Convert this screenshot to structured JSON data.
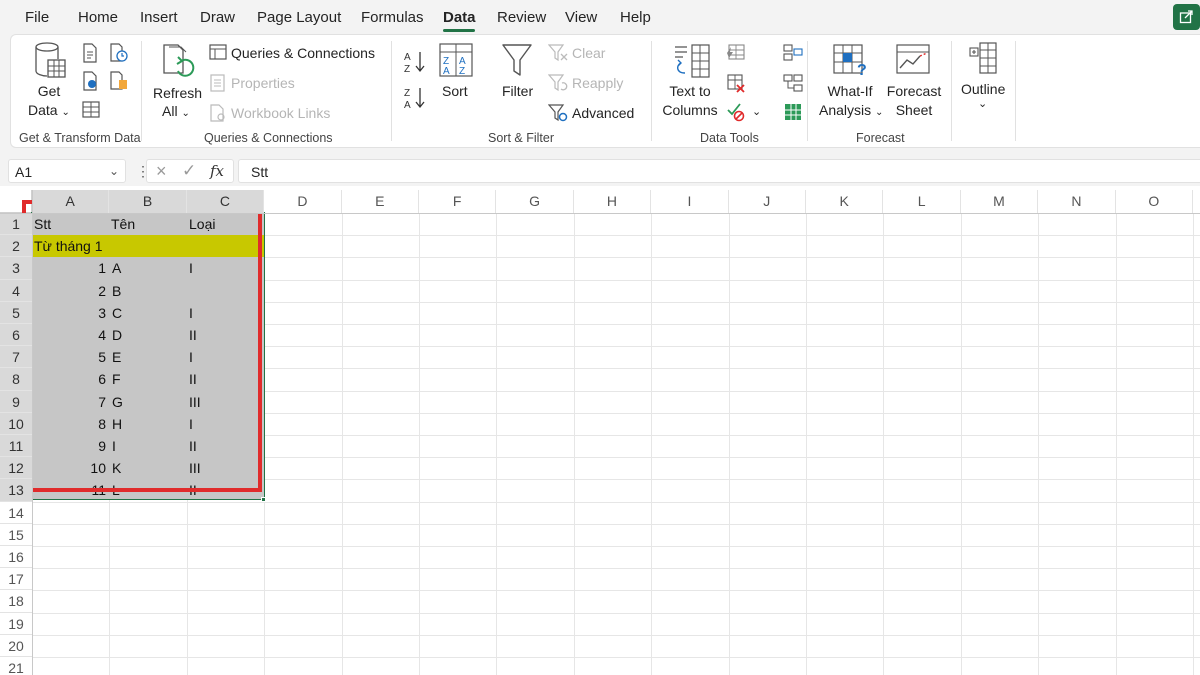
{
  "menu": {
    "items": [
      "File",
      "Home",
      "Insert",
      "Draw",
      "Page Layout",
      "Formulas",
      "Data",
      "Review",
      "View",
      "Help"
    ],
    "active": "Data"
  },
  "ribbon": {
    "get_transform": {
      "get_data_line1": "Get",
      "get_data_line2": "Data",
      "label": "Get & Transform Data"
    },
    "queries": {
      "queries_connections": "Queries & Connections",
      "properties": "Properties",
      "workbook_links": "Workbook Links",
      "refresh_line1": "Refresh",
      "refresh_line2": "All",
      "label": "Queries & Connections"
    },
    "sort_filter": {
      "sort": "Sort",
      "filter": "Filter",
      "clear": "Clear",
      "reapply": "Reapply",
      "advanced": "Advanced",
      "label": "Sort & Filter"
    },
    "data_tools": {
      "text_to_columns_line1": "Text to",
      "text_to_columns_line2": "Columns",
      "label": "Data Tools"
    },
    "forecast": {
      "what_if_line1": "What-If",
      "what_if_line2": "Analysis",
      "forecast_sheet_line1": "Forecast",
      "forecast_sheet_line2": "Sheet",
      "label": "Forecast"
    },
    "outline": {
      "outline": "Outline"
    }
  },
  "formula_bar": {
    "name_box": "A1",
    "fx": "fx",
    "content": "Stt"
  },
  "sheet": {
    "columns": [
      "A",
      "B",
      "C",
      "D",
      "E",
      "F",
      "G",
      "H",
      "I",
      "J",
      "K",
      "L",
      "M",
      "N",
      "O"
    ],
    "rows": [
      "1",
      "2",
      "3",
      "4",
      "5",
      "6",
      "7",
      "8",
      "9",
      "10",
      "11",
      "12",
      "13",
      "14",
      "15",
      "16",
      "17",
      "18",
      "19",
      "20",
      "21"
    ],
    "header": [
      "Stt",
      "Tên",
      "Loại"
    ],
    "section_label": "Từ tháng 1",
    "data": [
      [
        "1",
        "A",
        "I"
      ],
      [
        "2",
        "B",
        ""
      ],
      [
        "3",
        "C",
        "I"
      ],
      [
        "4",
        "D",
        "II"
      ],
      [
        "5",
        "E",
        "I"
      ],
      [
        "6",
        "F",
        "II"
      ],
      [
        "7",
        "G",
        "III"
      ],
      [
        "8",
        "H",
        "I"
      ],
      [
        "9",
        "I",
        "II"
      ],
      [
        "10",
        "K",
        "III"
      ],
      [
        "11",
        "L",
        "II"
      ]
    ]
  },
  "colors": {
    "accent": "#217346",
    "highlight_yellow": "#c8c800",
    "selection_fill": "#c6c6c6",
    "annotation_red": "#e02b2b"
  }
}
